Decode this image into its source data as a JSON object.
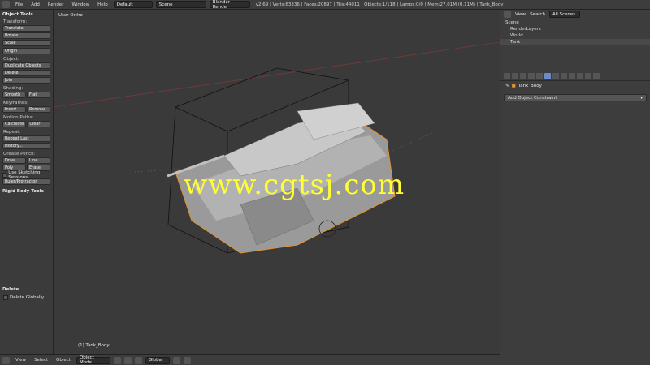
{
  "topbar": {
    "menus": [
      "File",
      "Add",
      "Render",
      "Window",
      "Help"
    ],
    "layout": "Default",
    "scene": "Scene",
    "engine": "Blender Render",
    "stats": "v2.69 | Verts:63336 | Faces:20897 | Tris:44011 | Objects:1/118 | Lamps:0/0 | Mem:27.01M (0.11M) | Tank_Body"
  },
  "toolshelf": {
    "title": "Object Tools",
    "transform_label": "Transform:",
    "translate": "Translate",
    "rotate": "Rotate",
    "scale": "Scale",
    "origin": "Origin",
    "object_label": "Object:",
    "duplicate": "Duplicate Objects",
    "delete": "Delete",
    "join": "Join",
    "shading_label": "Shading:",
    "smooth": "Smooth",
    "flat": "Flat",
    "keyframes_label": "Keyframes:",
    "insert": "Insert",
    "remove": "Remove",
    "motion_label": "Motion Paths:",
    "calculate": "Calculate",
    "clear": "Clear",
    "repeat_label": "Repeat:",
    "repeat_last": "Repeat Last",
    "history": "History...",
    "grease_label": "Grease Pencil:",
    "draw": "Draw",
    "line": "Line",
    "poly": "Poly",
    "erase": "Erase",
    "sketching": "Use Sketching Sessions",
    "ruler": "Ruler/Protractor",
    "rigid": "Rigid Body Tools",
    "delete_panel": "Delete",
    "delete_globally": "Delete Globally"
  },
  "viewport": {
    "view_label": "User Ortho",
    "object_label": "(1) Tank_Body",
    "watermark": "www.cgtsj.com"
  },
  "bottombar": {
    "view": "View",
    "select": "Select",
    "object": "Object",
    "mode": "Object Mode",
    "orientation": "Global"
  },
  "outliner": {
    "view": "View",
    "search": "Search",
    "filter": "All Scenes",
    "items": [
      "Scene",
      "RenderLayers",
      "World",
      "Tank"
    ]
  },
  "properties": {
    "object_name": "Tank_Body",
    "constraint_dropdown": "Add Object Constraint"
  },
  "colors": {
    "accent": "#e8912b",
    "watermark": "#ffff33"
  }
}
